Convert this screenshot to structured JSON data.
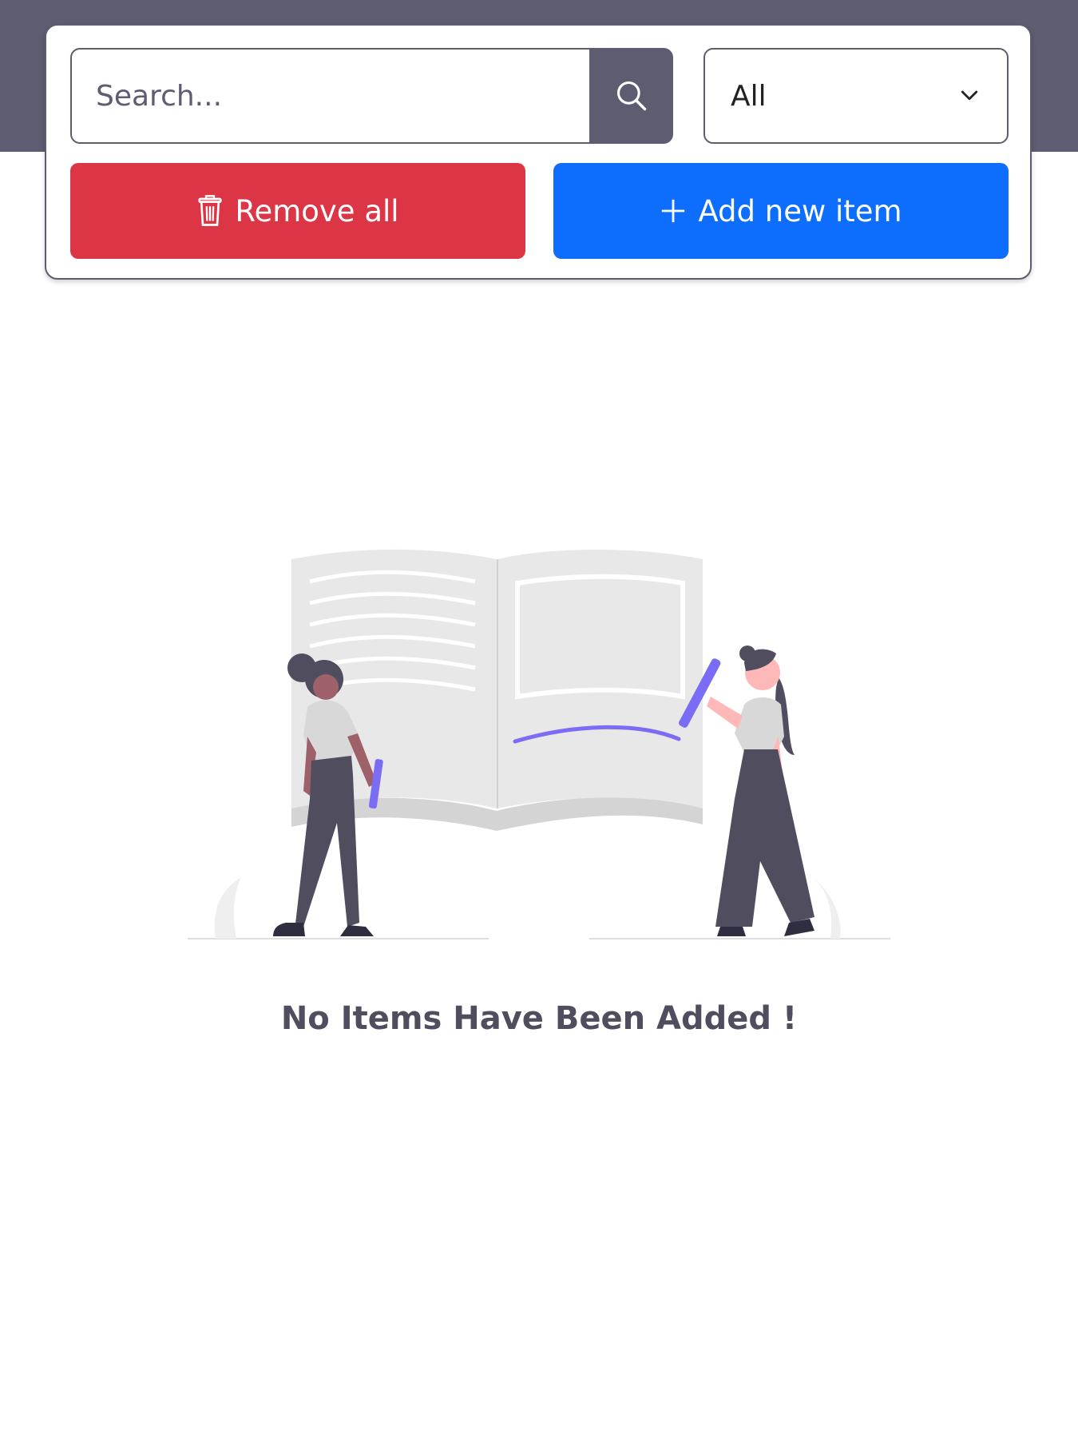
{
  "search": {
    "placeholder": "Search...",
    "value": ""
  },
  "filter": {
    "selected": "All"
  },
  "actions": {
    "remove_all_label": "Remove all",
    "add_new_label": "Add new item"
  },
  "empty_state": {
    "message": "No Items Have Been Added !"
  },
  "colors": {
    "header": "#5e5c71",
    "danger": "#dc3545",
    "primary": "#0d6efd",
    "accent": "#7b6cf6"
  },
  "icons": {
    "search": "search-icon",
    "dropdown": "chevron-down-icon",
    "remove": "trash-icon",
    "add": "plus-icon"
  }
}
